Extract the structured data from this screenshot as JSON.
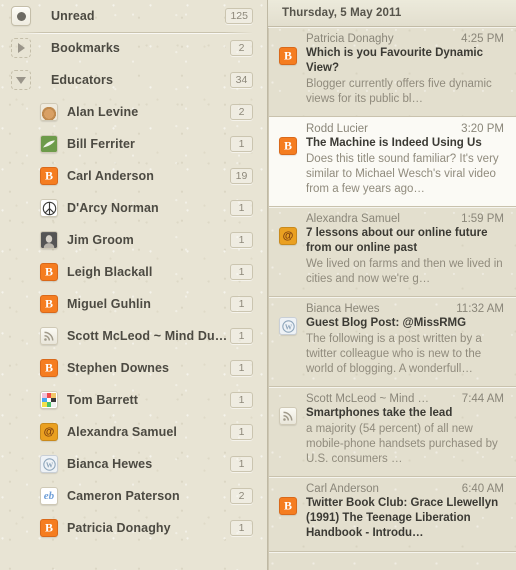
{
  "sidebar": {
    "rows": [
      {
        "type": "smart",
        "icon": "unread-dot-icon",
        "label": "Unread",
        "count": "125"
      },
      {
        "type": "group",
        "icon": "disclosure-right-icon",
        "label": "Bookmarks",
        "count": "2"
      },
      {
        "type": "group",
        "icon": "disclosure-down-icon",
        "label": "Educators",
        "count": "34"
      },
      {
        "type": "feed",
        "icon": "favicon-alan-levine",
        "label": "Alan Levine",
        "count": "2"
      },
      {
        "type": "feed",
        "icon": "favicon-bill-ferriter",
        "label": "Bill Ferriter",
        "count": "1"
      },
      {
        "type": "feed",
        "icon": "favicon-blogger",
        "label": "Carl Anderson",
        "count": "19"
      },
      {
        "type": "feed",
        "icon": "favicon-peace-sign",
        "label": "D'Arcy Norman",
        "count": "1"
      },
      {
        "type": "feed",
        "icon": "favicon-jim-groom",
        "label": "Jim Groom",
        "count": "1"
      },
      {
        "type": "feed",
        "icon": "favicon-blogger",
        "label": "Leigh Blackall",
        "count": "1"
      },
      {
        "type": "feed",
        "icon": "favicon-blogger",
        "label": "Miguel Guhlin",
        "count": "1"
      },
      {
        "type": "feed",
        "icon": "favicon-rss",
        "label": "Scott McLeod ~ Mind Dump",
        "count": "1"
      },
      {
        "type": "feed",
        "icon": "favicon-blogger",
        "label": "Stephen Downes",
        "count": "1"
      },
      {
        "type": "feed",
        "icon": "favicon-color-grid",
        "label": "Tom Barrett",
        "count": "1"
      },
      {
        "type": "feed",
        "icon": "favicon-at-sign",
        "label": "Alexandra Samuel",
        "count": "1"
      },
      {
        "type": "feed",
        "icon": "favicon-wordpress",
        "label": "Bianca Hewes",
        "count": "1"
      },
      {
        "type": "feed",
        "icon": "favicon-eb",
        "label": "Cameron Paterson",
        "count": "2"
      },
      {
        "type": "feed",
        "icon": "favicon-blogger",
        "label": "Patricia Donaghy",
        "count": "1"
      }
    ]
  },
  "list": {
    "header_date": "Thursday, 5 May 2011",
    "items": [
      {
        "icon": "favicon-blogger",
        "author": "Patricia Donaghy",
        "time": "4:25 PM",
        "title": "Which is you Favourite Dynamic View?",
        "snippet": "Blogger currently offers five dynamic views for its public bl…",
        "selected": false
      },
      {
        "icon": "favicon-blogger",
        "author": "Rodd Lucier",
        "time": "3:20 PM",
        "title": "The Machine is Indeed Using Us",
        "snippet": "Does this title sound familiar?  It's very similar to Michael Wesch's viral video from a few years ago…",
        "selected": true
      },
      {
        "icon": "favicon-at-sign",
        "author": "Alexandra Samuel",
        "time": "1:59 PM",
        "title": "7 lessons about our online future from our online past",
        "snippet": "We lived on farms and then we lived in cities and now we're g…",
        "selected": false
      },
      {
        "icon": "favicon-wordpress",
        "author": "Bianca Hewes",
        "time": "11:32 AM",
        "title": "Guest Blog Post: @MissRMG",
        "snippet": "The following is a post written by a twitter colleague who is new to the world of blogging. A wonderfull…",
        "selected": false
      },
      {
        "icon": "favicon-rss",
        "author": "Scott McLeod ~ Mind …",
        "time": "7:44 AM",
        "title": "Smartphones take the lead",
        "snippet": "a majority (54 percent) of all new mobile-phone handsets purchased by U.S. consumers …",
        "selected": false
      },
      {
        "icon": "favicon-blogger",
        "author": "Carl Anderson",
        "time": "6:40 AM",
        "title": "Twitter Book Club: Grace Llewellyn (1991) The Teenage Liberation Handbook - Introdu…",
        "snippet": "",
        "selected": false
      }
    ]
  },
  "colors": {
    "sidebar_bg": "#e8e4d4",
    "list_bg": "#e3dfce",
    "selected_bg": "#fbfaf5",
    "blogger_orange": "#f57d20",
    "at_sign_gold": "#eaa021",
    "text_dark": "#3b3a34",
    "text_muted": "#8a8679"
  }
}
